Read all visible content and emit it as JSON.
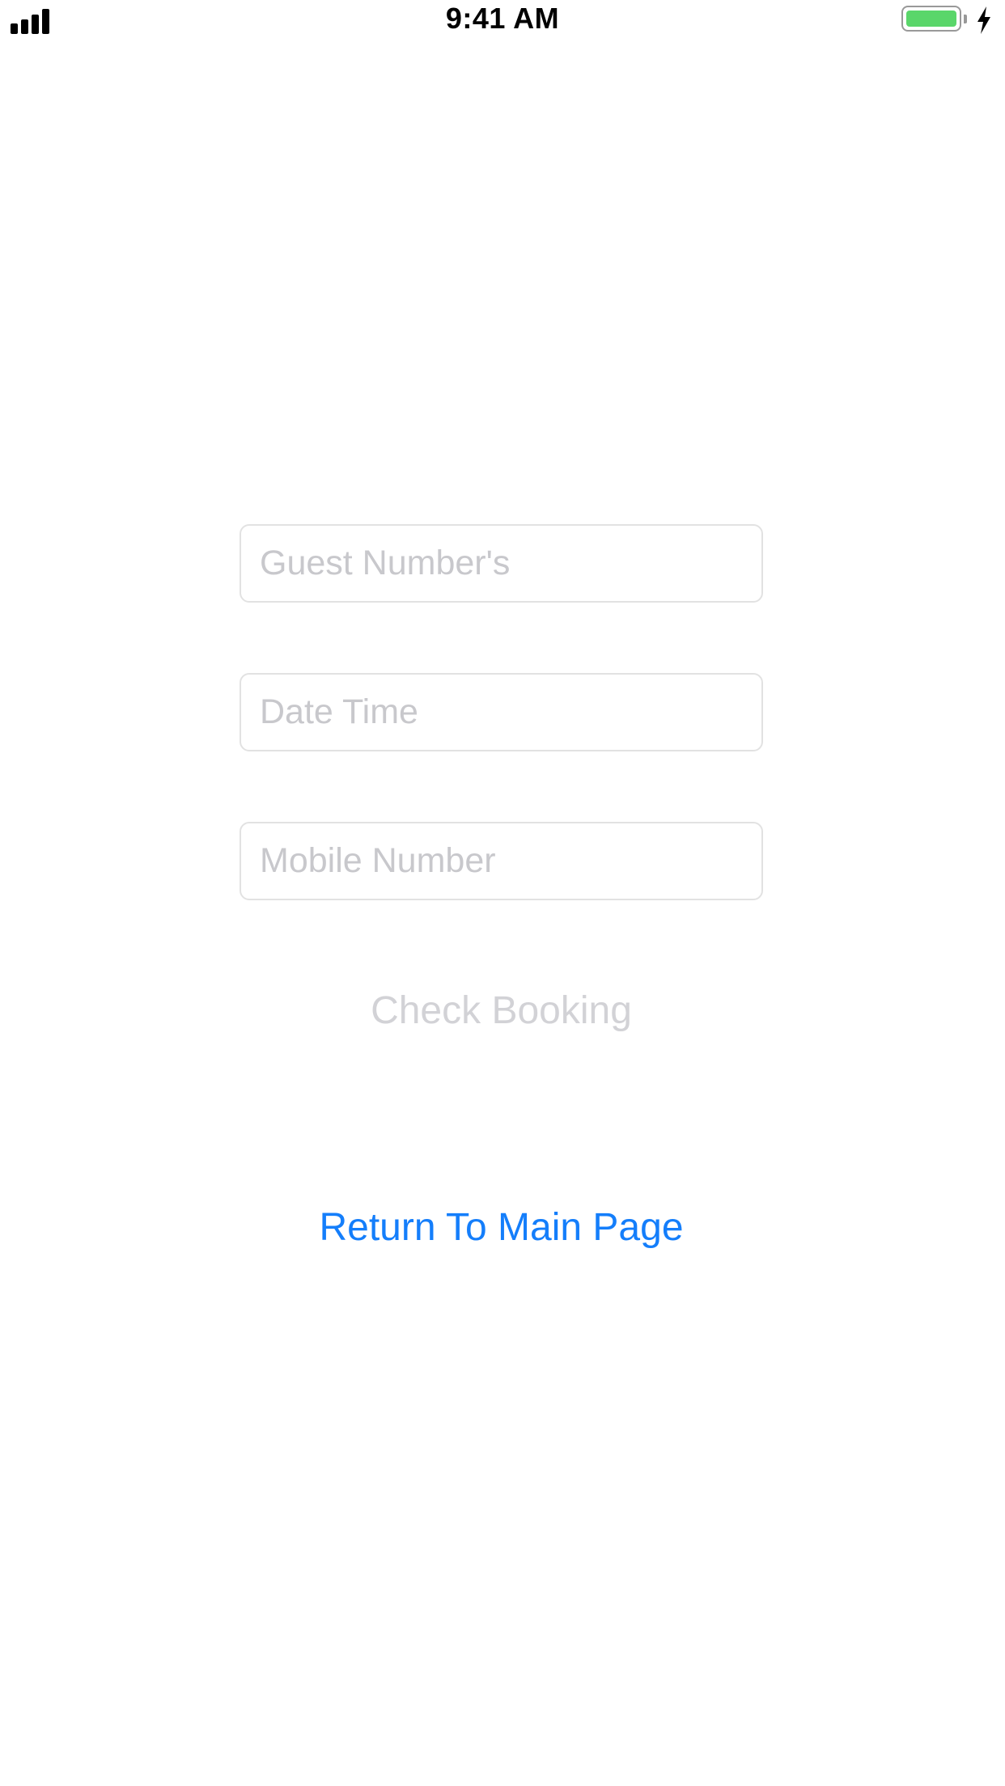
{
  "status_bar": {
    "time": "9:41 AM",
    "signal_icon": "cellular-signal-icon",
    "battery_icon": "battery-icon",
    "charging_icon": "charging-bolt-icon",
    "battery_level": 1.0,
    "battery_color": "#5ad66a"
  },
  "form": {
    "guests_placeholder": "Guest Number's",
    "guests_value": "",
    "datetime_placeholder": "Date Time",
    "datetime_value": "",
    "mobile_placeholder": "Mobile Number",
    "mobile_value": "",
    "check_button_label": "Check Booking"
  },
  "navigation": {
    "return_label": "Return To Main Page",
    "link_color": "#147efb"
  }
}
